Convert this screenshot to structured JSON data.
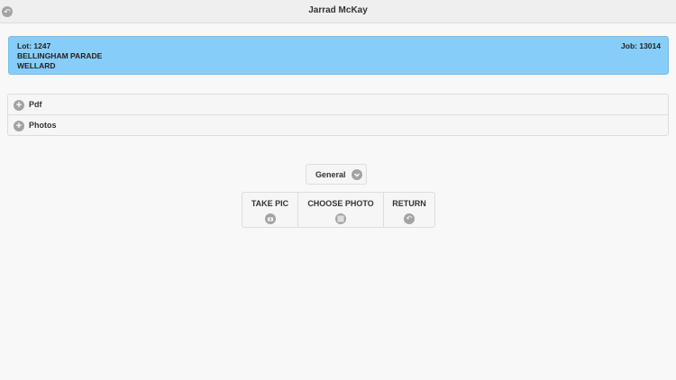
{
  "header": {
    "title": "Jarrad McKay",
    "back_icon": "back-arrow-icon"
  },
  "job_card": {
    "lot": "Lot: 1247",
    "street": "BELLINGHAM PARADE",
    "suburb": "WELLARD",
    "job": "Job: 13014",
    "background_color": "#87cdfa"
  },
  "sections": [
    {
      "label": "Pdf",
      "icon": "plus-icon"
    },
    {
      "label": "Photos",
      "icon": "plus-icon"
    }
  ],
  "category_select": {
    "selected": "General",
    "icon": "chevron-down-icon"
  },
  "actions": [
    {
      "label": "TAKE PIC",
      "icon": "camera-icon"
    },
    {
      "label": "CHOOSE PHOTO",
      "icon": "grid-icon"
    },
    {
      "label": "RETURN",
      "icon": "return-arrow-icon"
    }
  ]
}
